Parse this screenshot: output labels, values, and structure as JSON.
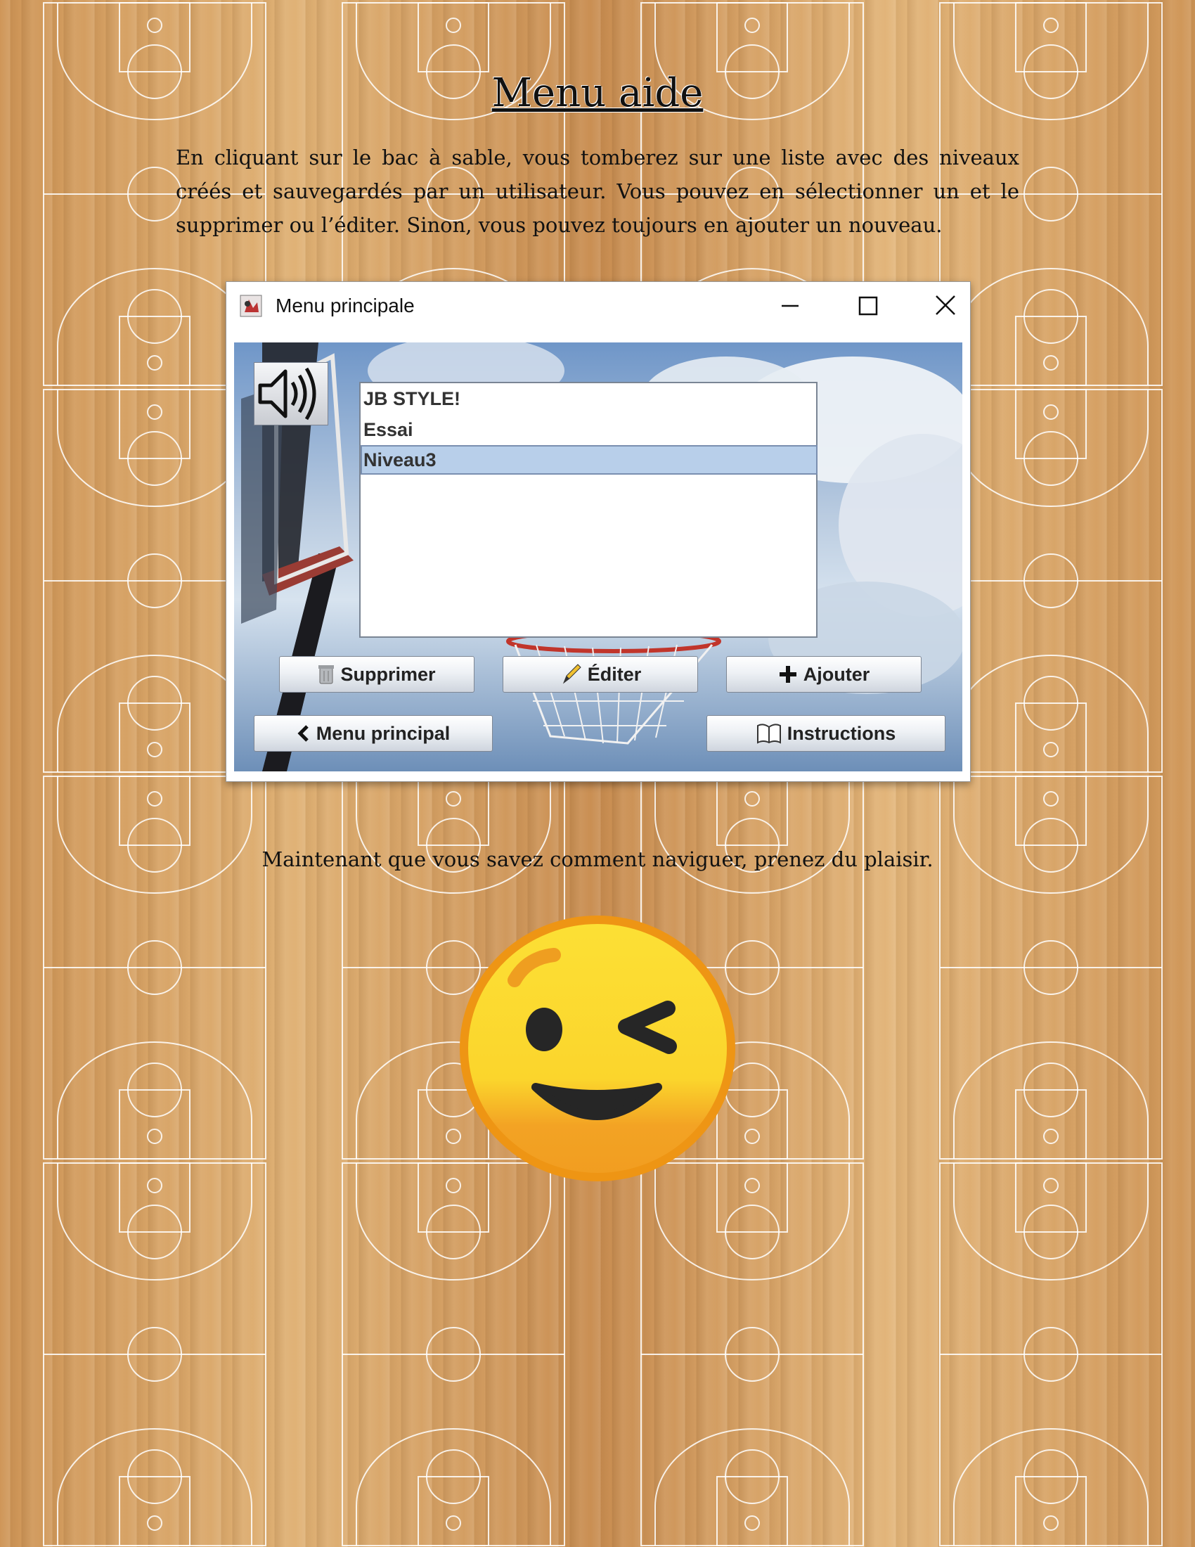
{
  "page": {
    "title": "Menu aide",
    "intro": "En cliquant sur le bac à sable, vous tomberez sur une liste avec des niveaux créés et sauvegardés par un utilisateur. Vous pouvez en sélectionner un et le supprimer ou l’éditer. Sinon, vous pouvez toujours en ajouter un nouveau.",
    "outro": "Maintenant que vous savez comment naviguer, prenez du plaisir."
  },
  "window": {
    "title": "Menu principale",
    "controls": {
      "minimize_icon": "minimize-icon",
      "maximize_icon": "maximize-icon",
      "close_icon": "close-icon"
    },
    "sound_icon": "speaker-icon",
    "levels": [
      "JB STYLE!",
      "Essai",
      "Niveau3"
    ],
    "selected_level": "Niveau3",
    "buttons": {
      "supprimer": "Supprimer",
      "editer": "Éditer",
      "ajouter": "Ajouter",
      "menu_principal": "Menu principal",
      "instructions": "Instructions"
    }
  },
  "emoji": "winking-face",
  "colors": {
    "selection": "#b8cfea",
    "wood": "#d9a566",
    "emoji_yellow": "#fce035",
    "emoji_orange": "#f0a020"
  }
}
